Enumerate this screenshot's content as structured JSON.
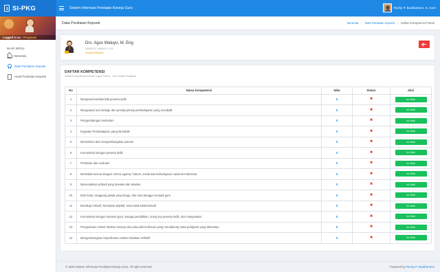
{
  "topbar": {
    "app_name": "SI-PKG",
    "title": "Sistem Informasi Penilaian Kinerja Guru",
    "user_name": "Rezky P. Budihartono, S. Kom"
  },
  "sidebar": {
    "logged_in_label": "Logged in as :",
    "logged_in_role": "Pengawas",
    "menu_header": "MAIN MENU",
    "items": [
      {
        "label": "Beranda",
        "icon": "home-icon",
        "active": false
      },
      {
        "label": "Data Penilaian Kepsek",
        "icon": "award-icon",
        "active": true
      },
      {
        "label": "Hasil Penilaian Kepsek",
        "icon": "file-icon",
        "active": false
      }
    ]
  },
  "page_header": {
    "title": "Data Penilaian Kepsek",
    "breadcrumbs": [
      "Beranda",
      "Data Penilaian Kepsek",
      "Daftar Kompetensi Pokok"
    ]
  },
  "profile": {
    "name": "Drs. Agus Waluyo, M. Eng",
    "nip": "19661027 199402 1 011",
    "status": "Kepala Sekolah"
  },
  "competency": {
    "title": "DAFTAR KOMPETENSI",
    "subtitle": "Daftar Kompetensi terkait Tugas Pokok - Guru Mata Pelajaran",
    "headers": {
      "no": "No",
      "kompetensi": "Nama Kompetensi",
      "nilai": "Nilai",
      "status": "Status",
      "aksi": "Aksi"
    },
    "action_label": "Isi Nilai",
    "status_mark": "✖",
    "rows": [
      {
        "no": "1",
        "name": "Mengenal karakteristik peserta didik",
        "nilai": "0"
      },
      {
        "no": "2",
        "name": "Menguasai teori belajar dan prinsip-prinsip pembelajaran yang mendidik",
        "nilai": "0"
      },
      {
        "no": "3",
        "name": "Pengembangan kurikulum",
        "nilai": "0"
      },
      {
        "no": "4",
        "name": "Kegiatan Pembelajaran yang Mendidik",
        "nilai": "0"
      },
      {
        "no": "5",
        "name": "Memahami dan mengembangkan potensi",
        "nilai": "0"
      },
      {
        "no": "6",
        "name": "Komunikasi dengan peserta didik",
        "nilai": "0"
      },
      {
        "no": "7",
        "name": "Penilaian dan evaluasi",
        "nilai": "0"
      },
      {
        "no": "8",
        "name": "Bertindak sesuai dengan norma agama, hukum, sosial dan kebudayaan nasional Indonesia",
        "nilai": "0"
      },
      {
        "no": "9",
        "name": "Menunjukkan pribadi yang dewasa dan teladan",
        "nilai": "0"
      },
      {
        "no": "10",
        "name": "Etos kerja, tanggung jawab yang tinggi, dan rasa bangga menjadi guru",
        "nilai": "0"
      },
      {
        "no": "11",
        "name": "Bersikap inklusif, bertindak objektif, serta tidak Diskriminatif",
        "nilai": "0"
      },
      {
        "no": "12",
        "name": "Komunikasi dengan sesama guru, tenaga pendidikan, orang tua peserta didik, dan masyarakat",
        "nilai": "0"
      },
      {
        "no": "13",
        "name": "Penguasaan materi struktur konsep dan pola pikir keilmuan yang mendukung mata pelajaran yang diimampu",
        "nilai": "0"
      },
      {
        "no": "14",
        "name": "Mengembangkan keprofesian melalui tindakan reflektif",
        "nilai": "0"
      }
    ]
  },
  "footer": {
    "copyright": "© 2020 Sistem Informasi Penilaian Kinerja Guru. All right reserved",
    "powered_prefix": "Powered by",
    "powered_name": "Rezky P. Budihartono"
  }
}
